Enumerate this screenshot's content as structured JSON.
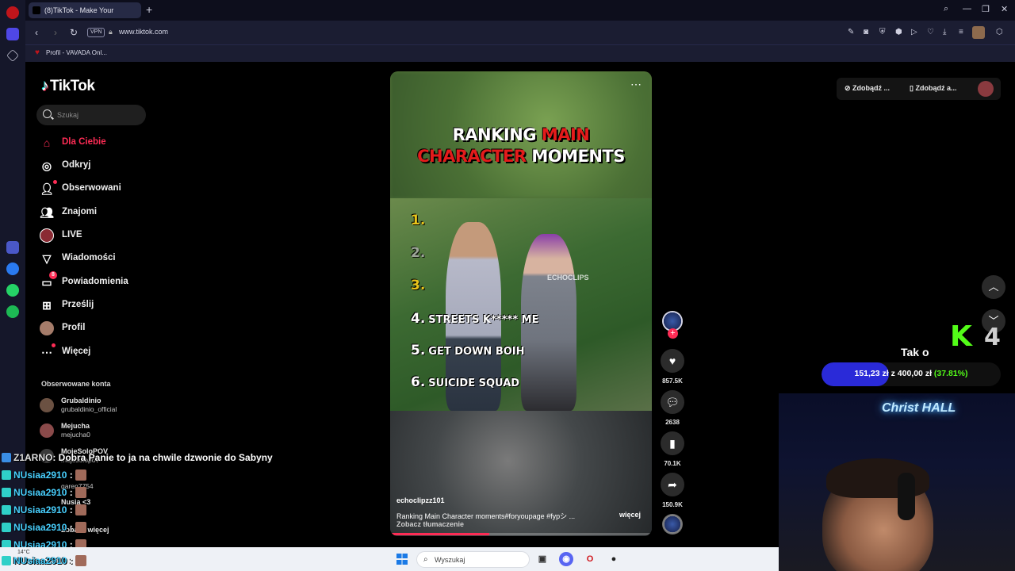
{
  "browser": {
    "tab_title": "(8)TikTok - Make Your",
    "new_tab": "+",
    "vpn": "VPN",
    "url": "www.tiktok.com",
    "bookmark": "Profil - VAVADA Onl..."
  },
  "sidebar": {
    "logo": "TikTok",
    "search_placeholder": "Szukaj",
    "items": [
      {
        "label": "Dla Ciebie",
        "icon": "home-icon"
      },
      {
        "label": "Odkryj",
        "icon": "compass-icon"
      },
      {
        "label": "Obserwowani",
        "icon": "following-icon"
      },
      {
        "label": "Znajomi",
        "icon": "friends-icon"
      },
      {
        "label": "LIVE",
        "icon": "live-icon"
      },
      {
        "label": "Wiadomości",
        "icon": "messages-icon"
      },
      {
        "label": "Powiadomienia",
        "icon": "inbox-icon",
        "badge": "8"
      },
      {
        "label": "Prześlij",
        "icon": "upload-icon"
      },
      {
        "label": "Profil",
        "icon": "profile-icon"
      },
      {
        "label": "Więcej",
        "icon": "more-icon"
      }
    ],
    "following_header": "Obserwowane konta",
    "accounts": [
      {
        "name": "Grubaldinio",
        "username": "grubaldinio_official"
      },
      {
        "name": "Mejucha",
        "username": "mejucha0"
      },
      {
        "name": "MojeSoloPOV",
        "username": "mojesolopov"
      },
      {
        "name": "",
        "username": "garen7754"
      },
      {
        "name": "Nusia <3",
        "username": ""
      }
    ],
    "see_more": "Zobacz więcej"
  },
  "video": {
    "title_line1_white": "RANKING ",
    "title_line1_red": "MAIN",
    "title_line2_red": "CHARACTER",
    "title_line2_white": " MOMENTS",
    "ranks": [
      {
        "num": "1.",
        "text": ""
      },
      {
        "num": "2.",
        "text": ""
      },
      {
        "num": "3.",
        "text": ""
      },
      {
        "num": "4.",
        "text": "STREETS K***** ME"
      },
      {
        "num": "5.",
        "text": "GET DOWN BOIH"
      },
      {
        "num": "6.",
        "text": "SUICIDE SQUAD"
      }
    ],
    "watermark": "ECHOCLIPS",
    "author": "echoclipzz101",
    "description": "Ranking Main Character moments#foryoupage  #fypシ  ...",
    "translate": "Zobacz tłumaczenie",
    "more": "więcej",
    "progress": 0.38
  },
  "actions": {
    "likes": "857.5K",
    "comments": "2638",
    "saves": "70.1K",
    "shares": "150.9K"
  },
  "topright": {
    "coins": "Zdobądź ...",
    "app": "Zdobądź a..."
  },
  "stream": {
    "k_number": "4",
    "alert": "Tak o",
    "goal_current": "151,23 zł",
    "goal_sep": " z ",
    "goal_target": "400,00 zł",
    "goal_pct": "(37.81%)",
    "goal_fraction": 0.3781,
    "neon": "Christ HALL"
  },
  "chat": [
    {
      "user": "Z1ARNO",
      "msg": ": Dobra Panie to ja na chwile dzwonie do Sabyny",
      "emote": false
    },
    {
      "user": "NUsiaa2910",
      "msg": " :",
      "emote": true
    },
    {
      "user": "NUsiaa2910",
      "msg": " :",
      "emote": true
    },
    {
      "user": "NUsiaa2910",
      "msg": " :",
      "emote": true
    },
    {
      "user": "NUsiaa2910",
      "msg": " :",
      "emote": true
    },
    {
      "user": "NUsiaa2910",
      "msg": " :",
      "emote": true
    },
    {
      "user": "NUsiaa2910",
      "msg": " :",
      "emote": true
    }
  ],
  "taskbar": {
    "temp": "14°C",
    "search": "Wyszukaj"
  }
}
